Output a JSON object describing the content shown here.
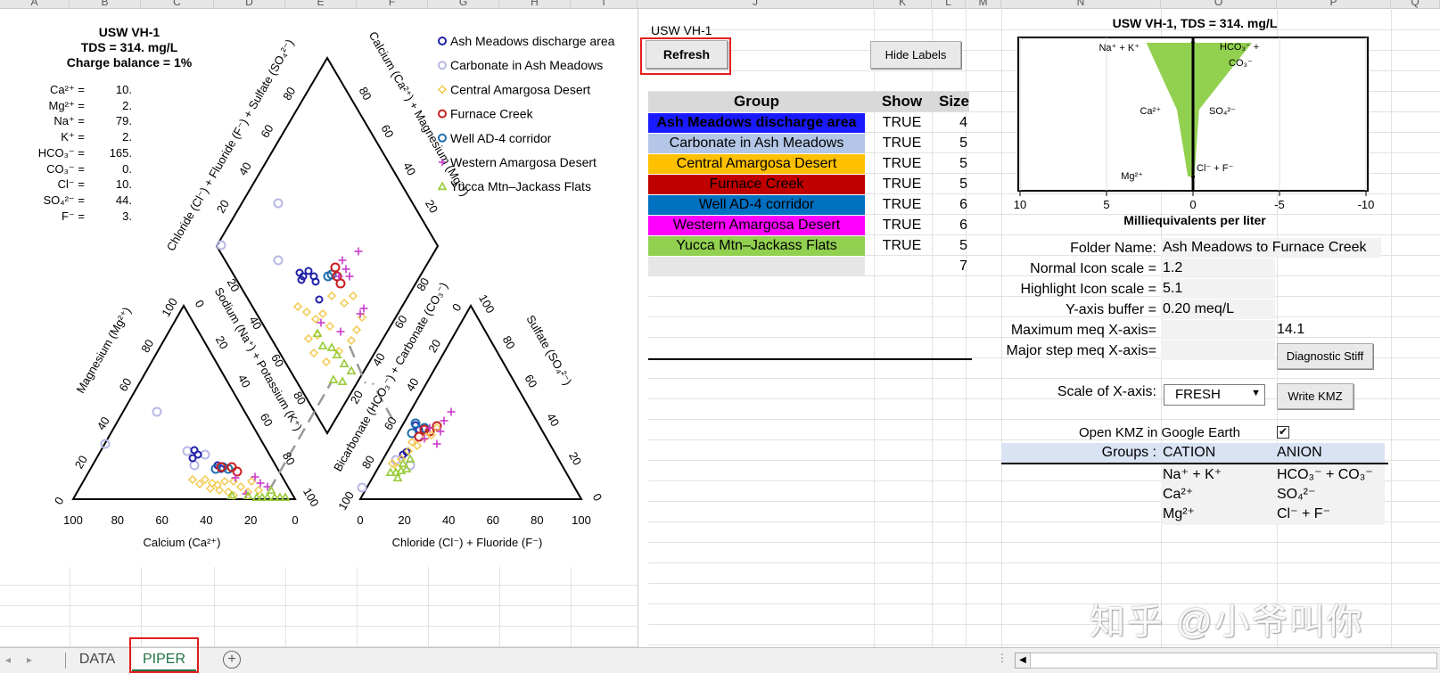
{
  "columns": [
    "A",
    "B",
    "C",
    "D",
    "E",
    "F",
    "G",
    "H",
    "I",
    "J",
    "K",
    "L",
    "M",
    "N",
    "O",
    "P",
    "Q"
  ],
  "piper": {
    "title": "USW VH-1",
    "tds": "TDS = 314. mg/L",
    "charge": "Charge balance = 1%",
    "ions": [
      {
        "name": "Ca²⁺ =",
        "value": "10."
      },
      {
        "name": "Mg²⁺ =",
        "value": "2."
      },
      {
        "name": "Na⁺ =",
        "value": "79."
      },
      {
        "name": "K⁺ =",
        "value": "2."
      },
      {
        "name": "HCO₃⁻ =",
        "value": "165."
      },
      {
        "name": "CO₃⁻ =",
        "value": "0."
      },
      {
        "name": "Cl⁻ =",
        "value": "10."
      },
      {
        "name": "SO₄²⁻ =",
        "value": "44."
      },
      {
        "name": "F⁻ =",
        "value": "3."
      }
    ],
    "legend": [
      {
        "label": "Ash Meadows discharge area",
        "color": "#1f1fa8",
        "marker": "circle"
      },
      {
        "label": "Carbonate in Ash Meadows",
        "color": "#b7b7e6",
        "marker": "circle"
      },
      {
        "label": "Central Amargosa Desert",
        "color": "#f2c84b",
        "marker": "diamond"
      },
      {
        "label": "Furnace Creek",
        "color": "#c81e1e",
        "marker": "circle"
      },
      {
        "label": "Well AD-4 corridor",
        "color": "#1f6fae",
        "marker": "circle"
      },
      {
        "label": "Western Amargosa Desert",
        "color": "#c83cc8",
        "marker": "plus"
      },
      {
        "label": "Yucca Mtn–Jackass Flats",
        "color": "#9acc3c",
        "marker": "triangle"
      }
    ],
    "axis_labels": {
      "magnesium": "Magnesium (Mg²⁺)",
      "sodium": "Sodium (Na⁺) + Potassium (K⁺)",
      "calcium": "Calcium (Ca²⁺)",
      "bicarbonate": "Bicarbonate (HCO₃⁻) + Carbonate (CO₃⁻)",
      "sulfate": "Sulfate (SO₄²⁻)",
      "chloride": "Chloride (Cl⁻) + Fluoride (F⁻)",
      "diamond_left": "Chloride (Cl⁻) + Fluoride (F⁻) + Sulfate (SO₄²⁻)",
      "diamond_right": "Calcium (Ca²⁺) + Magnesium (Mg²⁺)"
    },
    "ticks": [
      "0",
      "20",
      "40",
      "60",
      "80",
      "100"
    ]
  },
  "panel": {
    "sheet_name": "USW VH-1",
    "refresh": "Refresh",
    "hide_labels": "Hide Labels",
    "headers": {
      "group": "Group",
      "show": "Show",
      "size": "Size"
    },
    "groups": [
      {
        "name": "Ash Meadows discharge area",
        "show": "TRUE",
        "size": "4",
        "bg": "#1a1aff",
        "fg": "#000000",
        "bold": true
      },
      {
        "name": "Carbonate in Ash Meadows",
        "show": "TRUE",
        "size": "5",
        "bg": "#b4c6e7",
        "fg": "#000000",
        "bold": false
      },
      {
        "name": "Central Amargosa Desert",
        "show": "TRUE",
        "size": "5",
        "bg": "#ffc000",
        "fg": "#000000",
        "bold": false
      },
      {
        "name": "Furnace Creek",
        "show": "TRUE",
        "size": "5",
        "bg": "#c00000",
        "fg": "#000000",
        "bold": false
      },
      {
        "name": "Well AD-4 corridor",
        "show": "TRUE",
        "size": "6",
        "bg": "#0070c0",
        "fg": "#000000",
        "bold": false
      },
      {
        "name": "Western Amargosa Desert",
        "show": "TRUE",
        "size": "6",
        "bg": "#ff00ff",
        "fg": "#000000",
        "bold": false
      },
      {
        "name": "Yucca Mtn–Jackass Flats",
        "show": "TRUE",
        "size": "5",
        "bg": "#92d050",
        "fg": "#000000",
        "bold": false
      },
      {
        "name": "",
        "show": "",
        "size": "7",
        "bg": "#e6e6e6",
        "fg": "#000000",
        "bold": false
      }
    ]
  },
  "stiff": {
    "title": "USW VH-1, TDS = 314. mg/L",
    "xlabel": "Milliequivalents per liter",
    "ticks": [
      "10",
      "5",
      "0",
      "-5",
      "-10"
    ],
    "cation_labels": [
      "Na⁺ + K⁺",
      "Ca²⁺",
      "Mg²⁺"
    ],
    "anion_labels": [
      "HCO₃⁻ +",
      "CO₃⁻",
      "SO₄²⁻",
      "Cl⁻ + F⁻"
    ]
  },
  "settings": {
    "folder_label": "Folder Name:",
    "folder_value": "Ash Meadows to Furnace Creek",
    "normal_label": "Normal Icon scale =",
    "normal_value": "1.2",
    "highlight_label": "Highlight Icon scale =",
    "highlight_value": "5.1",
    "ybuffer_label": "Y-axis buffer =",
    "ybuffer_value": "0.20 meq/L",
    "maxmeq_label": "Maximum meq X-axis=",
    "maxmeq_value": "14.1",
    "major_label": "Major step meq X-axis=",
    "diag_btn": "Diagnostic Stiff",
    "scale_label": "Scale of X-axis:",
    "scale_value": "FRESH",
    "kmz_btn": "Write KMZ",
    "open_kmz_label": "Open KMZ in Google Earth",
    "groups_label": "Groups :",
    "cation": "CATION",
    "anion": "ANION",
    "cations": [
      "Na⁺ + K⁺",
      "Ca²⁺",
      "Mg²⁺"
    ],
    "anions": [
      "HCO₃⁻ + CO₃⁻",
      "SO₄²⁻",
      "Cl⁻ + F⁻"
    ]
  },
  "sheets": {
    "data": "DATA",
    "piper": "PIPER"
  },
  "watermark": "知乎 @小爷叫你"
}
